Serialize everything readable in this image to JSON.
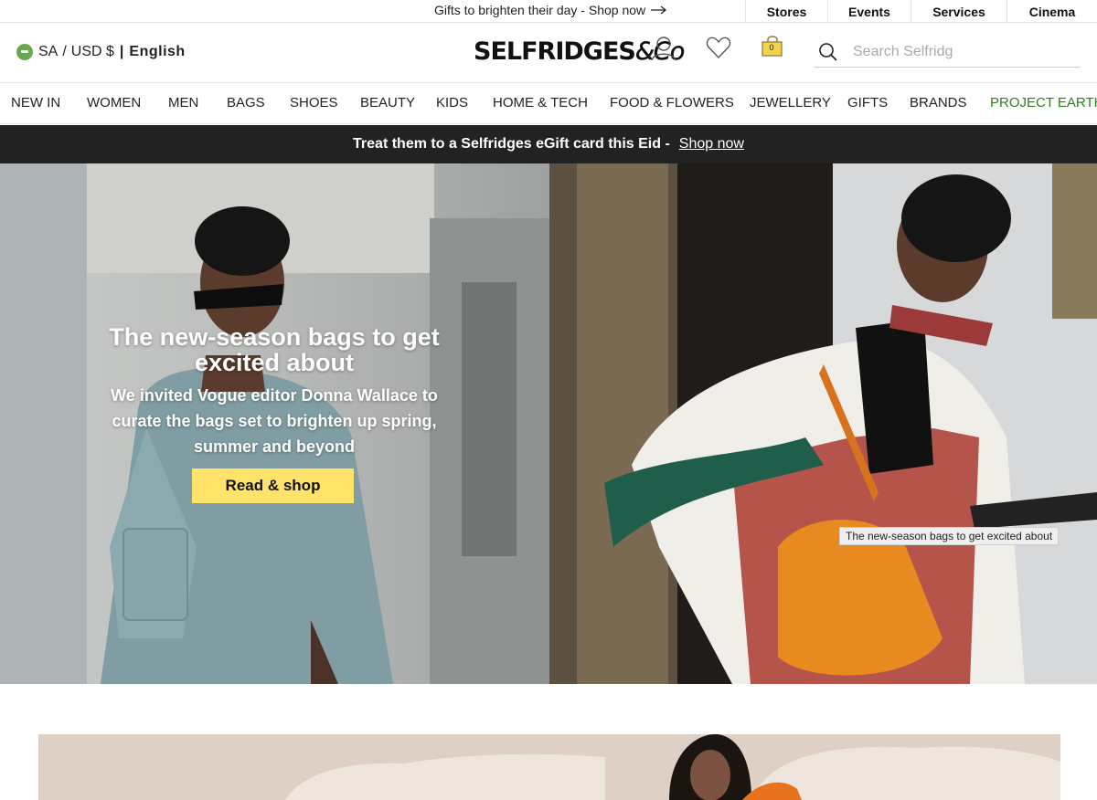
{
  "topbar": {
    "promo_text": "Gifts to brighten their day - Shop now",
    "links": [
      "Stores",
      "Events",
      "Services",
      "Cinema"
    ]
  },
  "header": {
    "locale": {
      "country": "SA",
      "currency": "USD $",
      "language": "English"
    },
    "logo": {
      "main": "SELFRIDGES",
      "suffix": "&Co"
    },
    "bag_count": "0",
    "search_placeholder": "Search Selfridges"
  },
  "nav": {
    "items": [
      "NEW IN",
      "WOMEN",
      "MEN",
      "BAGS",
      "SHOES",
      "BEAUTY",
      "KIDS",
      "HOME & TECH",
      "FOOD & FLOWERS",
      "JEWELLERY",
      "GIFTS",
      "BRANDS",
      "PROJECT EARTH"
    ]
  },
  "banner": {
    "text": "Treat them to a Selfridges eGift card this Eid -",
    "link": "Shop now"
  },
  "hero": {
    "title": "The new-season bags to get excited about",
    "subtitle": "We invited Vogue editor Donna Wallace to curate the bags set to brighten up spring, summer and beyond",
    "cta": "Read & shop",
    "tooltip": "The new-season bags to get excited about"
  },
  "colors": {
    "accent_yellow": "#ffe36b",
    "banner_bg": "#222222",
    "project_earth_green": "#2f7d1e"
  },
  "icons": [
    "arrow-right-icon",
    "flag-icon",
    "account-icon",
    "heart-icon",
    "shopping-bag-icon",
    "search-icon"
  ]
}
